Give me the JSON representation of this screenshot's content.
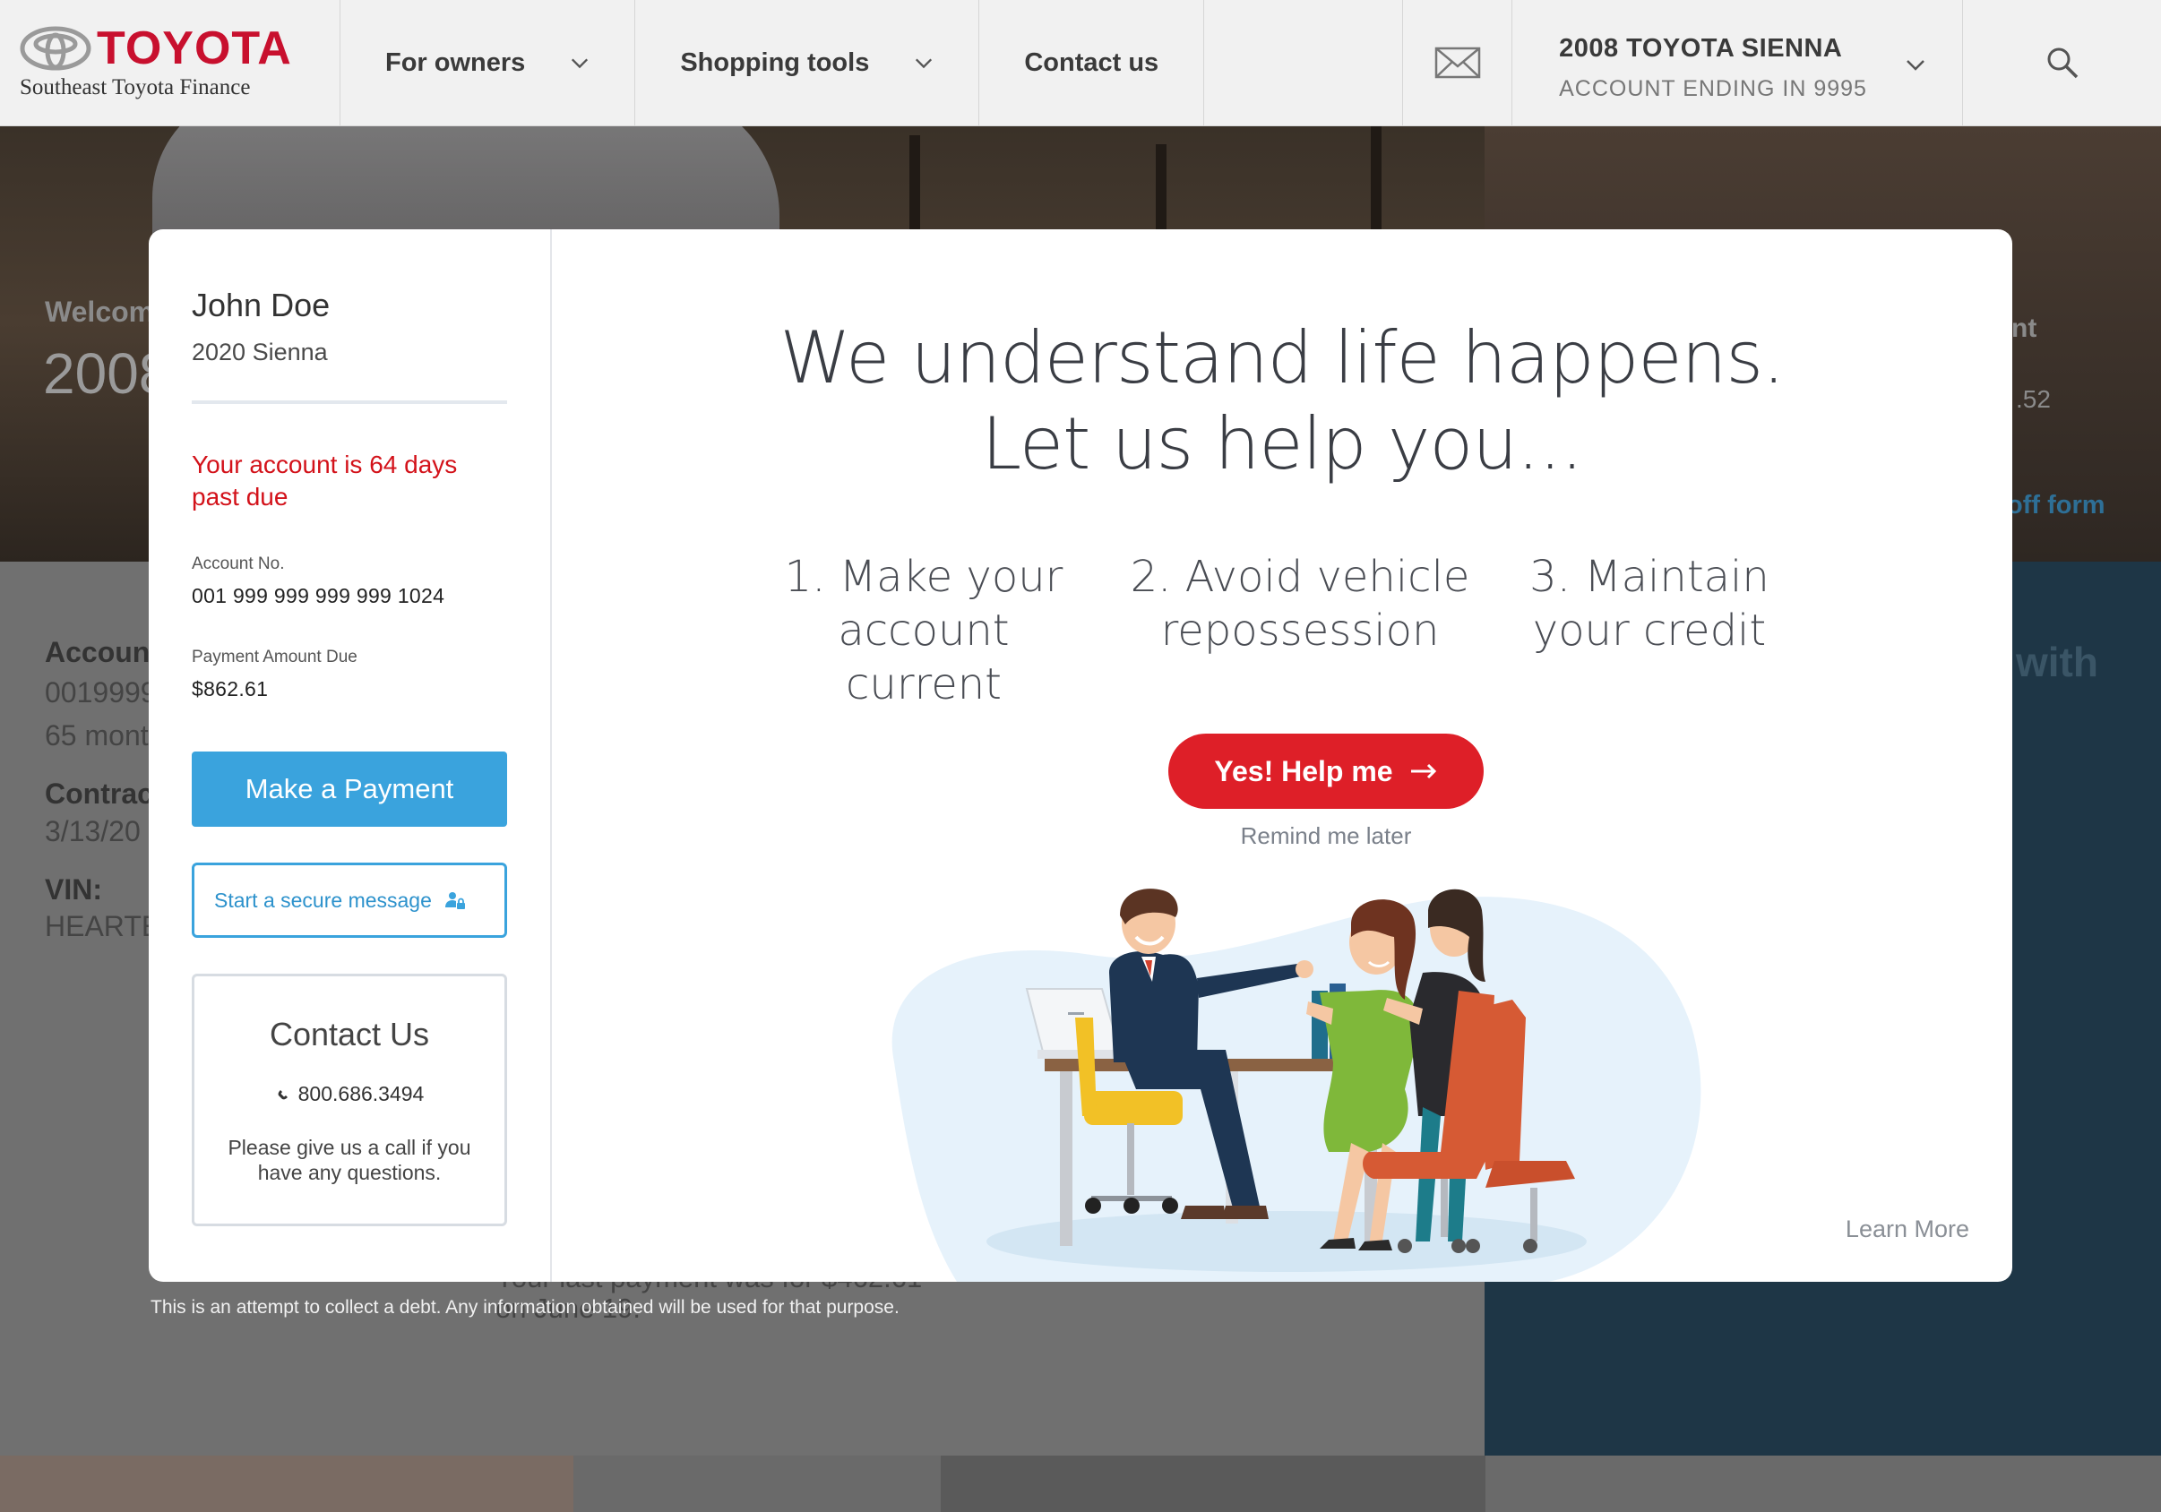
{
  "nav": {
    "logo_word": "TOYOTA",
    "logo_sub": "Southeast Toyota Finance",
    "items": [
      {
        "label": "For owners"
      },
      {
        "label": "Shopping tools"
      },
      {
        "label": "Contact us"
      }
    ],
    "vehicle_title": "2008 TOYOTA SIENNA",
    "vehicle_sub": "ACCOUNT ENDING IN 9995"
  },
  "background": {
    "welcome": "Welcom",
    "year": "2008",
    "acct_label": "Accoun",
    "acct_num": "0019999",
    "months": "65 mont",
    "contract_label": "Contrac",
    "contract_date": "3/13/20",
    "vin_label": "VIN:",
    "vin_value": "HEARTE",
    "right_text1": "nt",
    "right_text2": ".52",
    "right_text3": "off form",
    "right_with": "with",
    "last_payment_1": "Your last payment was for $462.61",
    "last_payment_2": "on June 19."
  },
  "modal": {
    "customer_name": "John Doe",
    "customer_vehicle": "2020 Sienna",
    "past_due": "Your account is 64 days past due",
    "account_label": "Account No.",
    "account_value": "001 999 999 999 999 1024",
    "payment_label": "Payment Amount Due",
    "payment_value": "$862.61",
    "pay_button": "Make a Payment",
    "message_button": "Start a secure message",
    "contact_title": "Contact Us",
    "contact_phone": "800.686.3494",
    "contact_note": "Please give us a call if you have any questions.",
    "headline_1": "We understand life happens.",
    "headline_2": "Let us help you...",
    "step1_a": "1. Make your",
    "step1_b": "account current",
    "step2_a": "2. Avoid vehicle",
    "step2_b": "repossession",
    "step3_a": "3. Maintain",
    "step3_b": "your credit",
    "yes_button": "Yes! Help me",
    "remind": "Remind me later",
    "learn_more": "Learn More"
  },
  "disclaimer": "This is an attempt to collect a debt. Any information obtained will be used for that purpose.",
  "colors": {
    "brand_red": "#c8102e",
    "cta_red": "#de1f28",
    "pay_blue": "#3aa3dd",
    "alert_red": "#d3121a"
  }
}
